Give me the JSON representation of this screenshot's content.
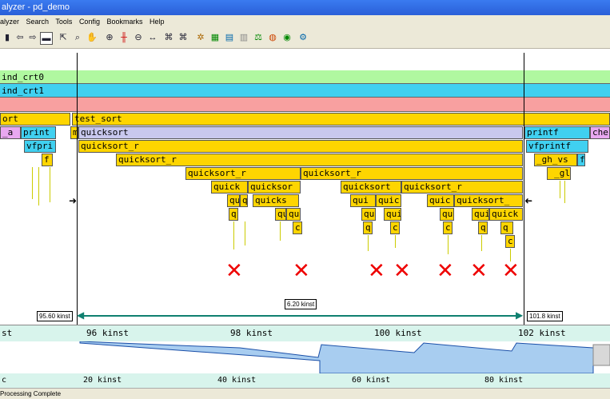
{
  "window": {
    "title": "alyzer - pd_demo"
  },
  "menu": [
    "alyzer",
    "Search",
    "Tools",
    "Config",
    "Bookmarks",
    "Help"
  ],
  "toolbar_icons": [
    "open-icon",
    "back-icon",
    "forward-icon",
    "zoom-fit-icon",
    "select-icon",
    "zoom-icon",
    "hand-icon",
    "zoom-in-icon",
    "marker-icon",
    "zoom-out-icon",
    "range-icon",
    "find-icon",
    "find-next-icon",
    "filter-icon",
    "stats-icon",
    "histogram-icon",
    "chart-icon",
    "scale-icon",
    "color-icon",
    "palette-icon",
    "settings-icon"
  ],
  "rows": {
    "row1": "ind_crt0",
    "row2": "ind_crt1"
  },
  "calls": {
    "sort": "ort",
    "test_sort": "test_sort",
    "a_": "_a",
    "print": "print",
    "m": "m",
    "quicksort": "quicksort",
    "quicksort_r_1": "quicksort_r",
    "quicksort_r_2": "quicksort_r",
    "quicksort_r_3": "quicksort_r",
    "quicksort_r_4": "quicksort_r",
    "vfpri": "vfpri",
    "f": "f",
    "quick_a": "quick",
    "quicksor": "quicksor",
    "quicksort_b": "quicksort",
    "quicksort_r_5": "quicksort_r",
    "quicks": "quicks",
    "qui1": "qui",
    "quic1": "quic",
    "quic2": "quic",
    "quicksort_c": "quicksort_",
    "qu1": "qu",
    "q1": "q",
    "qu2": "qu",
    "qu3": "qu",
    "qui2": "qui",
    "qu4": "qu",
    "qu5": "qu",
    "qui3": "qui",
    "quick2": "quick",
    "q2": "q",
    "c1": "c",
    "c2": "c",
    "c3": "c",
    "q3": "q",
    "q4": "q",
    "q5": "q",
    "c4": "c",
    "printf": "printf",
    "che": "che",
    "vfprintf": "vfprintf",
    "gh_vs": "_gh_vs",
    "f2": "f",
    "gl": "_gl"
  },
  "markers": {
    "left_time": "95.60 kinst",
    "range": "6.20 kinst",
    "right_time": "101.8 kinst"
  },
  "axis_top": [
    "st",
    "96 kinst",
    "98 kinst",
    "100 kinst",
    "102 kinst"
  ],
  "axis_bottom": [
    "c",
    "20 kinst",
    "40 kinst",
    "60 kinst",
    "80 kinst"
  ],
  "status": "Processing Complete",
  "colors": {
    "call": "#fed500",
    "row_green": "#b0f8a0",
    "row_cyan": "#40d0f0",
    "row_pink": "#f8a0a0",
    "error": "#e00000"
  }
}
